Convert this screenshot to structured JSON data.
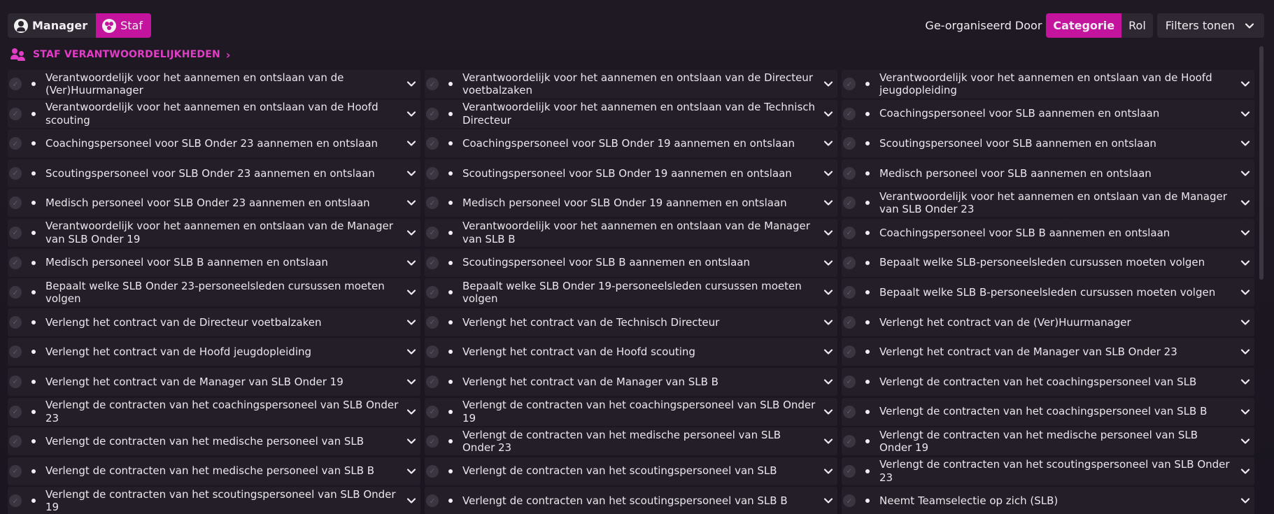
{
  "header": {
    "toggle": [
      {
        "label": "Manager",
        "icon": "person-icon",
        "active": false
      },
      {
        "label": "Staf",
        "icon": "group-icon",
        "active": true
      }
    ],
    "organized_by_label": "Ge-organiseerd Door",
    "organize_options": [
      {
        "label": "Categorie",
        "active": true
      },
      {
        "label": "Rol",
        "active": false
      }
    ],
    "filters_label": "Filters tonen"
  },
  "section": {
    "title": "STAF VERANTWOORDELIJKHEDEN",
    "icon": "staff-icon",
    "accent_color": "#e23dc6"
  },
  "colors": {
    "accent": "#c4139d",
    "background": "#1b1620",
    "cell": "#231e27"
  },
  "rows": [
    [
      "Verantwoordelijk voor het aannemen en ontslaan van de (Ver)Huurmanager",
      "Verantwoordelijk voor het aannemen en ontslaan van de Directeur voetbalzaken",
      "Verantwoordelijk voor het aannemen en ontslaan van de Hoofd jeugdopleiding"
    ],
    [
      "Verantwoordelijk voor het aannemen en ontslaan van de Hoofd scouting",
      "Verantwoordelijk voor het aannemen en ontslaan van de Technisch Directeur",
      "Coachingspersoneel voor SLB aannemen en ontslaan"
    ],
    [
      "Coachingspersoneel voor SLB Onder 23 aannemen en ontslaan",
      "Coachingspersoneel voor SLB Onder 19 aannemen en ontslaan",
      "Scoutingspersoneel voor SLB aannemen en ontslaan"
    ],
    [
      "Scoutingspersoneel voor SLB Onder 23 aannemen en ontslaan",
      "Scoutingspersoneel voor SLB Onder 19 aannemen en ontslaan",
      "Medisch personeel voor SLB aannemen en ontslaan"
    ],
    [
      "Medisch personeel voor SLB Onder 23 aannemen en ontslaan",
      "Medisch personeel voor SLB Onder 19 aannemen en ontslaan",
      "Verantwoordelijk voor het aannemen en ontslaan van de Manager van SLB Onder 23"
    ],
    [
      "Verantwoordelijk voor het aannemen en ontslaan van de Manager van SLB Onder 19",
      "Verantwoordelijk voor het aannemen en ontslaan van de Manager van SLB B",
      "Coachingspersoneel voor SLB B aannemen en ontslaan"
    ],
    [
      "Medisch personeel voor SLB B aannemen en ontslaan",
      "Scoutingspersoneel voor SLB B aannemen en ontslaan",
      "Bepaalt welke SLB-personeelsleden cursussen moeten volgen"
    ],
    [
      "Bepaalt welke SLB Onder 23-personeelsleden cursussen moeten volgen",
      "Bepaalt welke SLB Onder 19-personeelsleden cursussen moeten volgen",
      "Bepaalt welke SLB B-personeelsleden cursussen moeten volgen"
    ],
    [
      "Verlengt het contract van de Directeur voetbalzaken",
      "Verlengt het contract van de Technisch Directeur",
      "Verlengt het contract van de (Ver)Huurmanager"
    ],
    [
      "Verlengt het contract van de Hoofd jeugdopleiding",
      "Verlengt het contract van de Hoofd scouting",
      "Verlengt het contract van de Manager van SLB Onder 23"
    ],
    [
      "Verlengt het contract van de Manager van SLB Onder 19",
      "Verlengt het contract van de Manager van SLB B",
      "Verlengt de contracten van het coachingspersoneel van SLB"
    ],
    [
      "Verlengt de contracten van het coachingspersoneel van SLB Onder 23",
      "Verlengt de contracten van het coachingspersoneel van SLB Onder 19",
      "Verlengt de contracten van het coachingspersoneel van SLB B"
    ],
    [
      "Verlengt de contracten van het medische personeel van SLB",
      "Verlengt de contracten van het medische personeel van SLB Onder 23",
      "Verlengt de contracten van het medische personeel van SLB Onder 19"
    ],
    [
      "Verlengt de contracten van het medische personeel van SLB B",
      "Verlengt de contracten van het scoutingspersoneel van SLB",
      "Verlengt de contracten van het scoutingspersoneel van SLB Onder 23"
    ],
    [
      "Verlengt de contracten van het scoutingspersoneel van SLB Onder 19",
      "Verlengt de contracten van het scoutingspersoneel van SLB B",
      "Neemt Teamselectie op zich (SLB)"
    ]
  ]
}
